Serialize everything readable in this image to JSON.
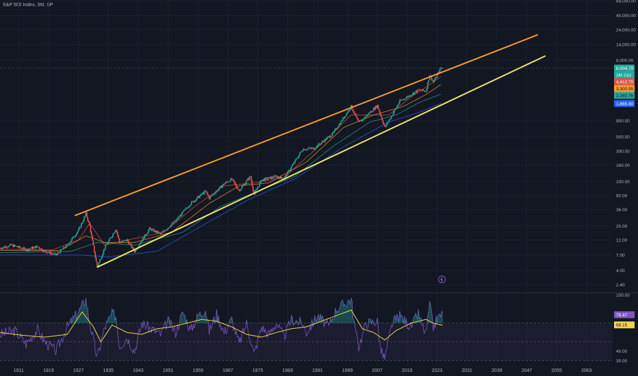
{
  "title": "S&P 500 Index, 3M, SP",
  "colors": {
    "background": "#131722",
    "up": "#26a69a",
    "down": "#ef5350",
    "upper_channel": "#f59b2d",
    "lower_channel": "#f2e46a",
    "ma_fast": "#e0524a",
    "ma_mid": "#f59b2d",
    "ma_slow": "#26a69a",
    "ma_slowest": "#2962ff",
    "rsi": "#7e57c2",
    "rsi_ma": "#f2d34d",
    "price_line": "#26a69a"
  },
  "chart_data": [
    {
      "type": "candlestick",
      "title": "S&P 500 Index, 3M, SP",
      "yscale": "log",
      "ylim": [
        1.8,
        70000
      ],
      "xlim": [
        1906,
        2070
      ],
      "x_ticks": [
        "1911",
        "1919",
        "1927",
        "1935",
        "1943",
        "1951",
        "1959",
        "1967",
        "1975",
        "1983",
        "1991",
        "1999",
        "2007",
        "2015",
        "2023",
        "2031",
        "2039",
        "2047",
        "2055",
        "2063"
      ],
      "y_ticks": [
        "68,000.00",
        "40,000.00",
        "24,000.00",
        "14,000.00",
        "8,000.00",
        "900.00",
        "500.00",
        "300.00",
        "180.00",
        "100.00",
        "60.00",
        "36.00",
        "20.00",
        "12.00",
        "7.00",
        "4.00",
        "2.40"
      ],
      "price_path": [
        [
          1906,
          9
        ],
        [
          1909,
          10
        ],
        [
          1913,
          8.5
        ],
        [
          1916,
          9.5
        ],
        [
          1918,
          8
        ],
        [
          1921,
          7
        ],
        [
          1924,
          10
        ],
        [
          1927,
          17
        ],
        [
          1929,
          31
        ],
        [
          1930,
          20
        ],
        [
          1932,
          4.5
        ],
        [
          1934,
          9
        ],
        [
          1937,
          18
        ],
        [
          1938,
          11
        ],
        [
          1940,
          12
        ],
        [
          1942,
          8
        ],
        [
          1946,
          18
        ],
        [
          1949,
          15
        ],
        [
          1953,
          24
        ],
        [
          1957,
          45
        ],
        [
          1961,
          70
        ],
        [
          1962,
          55
        ],
        [
          1966,
          92
        ],
        [
          1968,
          108
        ],
        [
          1970,
          72
        ],
        [
          1973,
          120
        ],
        [
          1974,
          63
        ],
        [
          1976,
          105
        ],
        [
          1980,
          120
        ],
        [
          1982,
          110
        ],
        [
          1987,
          320
        ],
        [
          1990,
          330
        ],
        [
          1995,
          550
        ],
        [
          2000,
          1500
        ],
        [
          2002,
          820
        ],
        [
          2007,
          1550
        ],
        [
          2009,
          700
        ],
        [
          2013,
          1800
        ],
        [
          2018,
          2700
        ],
        [
          2020,
          2600
        ],
        [
          2021,
          4700
        ],
        [
          2022,
          3600
        ],
        [
          2024,
          6000
        ]
      ],
      "moving_averages": [
        {
          "color": "#e0524a",
          "path": [
            [
              1906,
              8.6
            ],
            [
              1920,
              8.4
            ],
            [
              1927,
              12
            ],
            [
              1930,
              22
            ],
            [
              1934,
              10
            ],
            [
              1940,
              12
            ],
            [
              1950,
              16
            ],
            [
              1958,
              40
            ],
            [
              1966,
              85
            ],
            [
              1974,
              95
            ],
            [
              1982,
              115
            ],
            [
              1990,
              300
            ],
            [
              2000,
              1100
            ],
            [
              2005,
              1100
            ],
            [
              2010,
              1100
            ],
            [
              2016,
              2100
            ],
            [
              2020,
              3000
            ],
            [
              2024,
              4412
            ]
          ]
        },
        {
          "color": "#f59b2d",
          "path": [
            [
              1906,
              8.2
            ],
            [
              1922,
              8.2
            ],
            [
              1929,
              14
            ],
            [
              1934,
              11
            ],
            [
              1942,
              11
            ],
            [
              1952,
              16
            ],
            [
              1962,
              45
            ],
            [
              1970,
              85
            ],
            [
              1978,
              95
            ],
            [
              1988,
              200
            ],
            [
              1998,
              700
            ],
            [
              2006,
              1100
            ],
            [
              2014,
              1500
            ],
            [
              2020,
              2300
            ],
            [
              2024,
              3300
            ]
          ]
        },
        {
          "color": "#26a69a",
          "path": [
            [
              1906,
              7.6
            ],
            [
              1925,
              8
            ],
            [
              1932,
              11
            ],
            [
              1942,
              10
            ],
            [
              1955,
              16
            ],
            [
              1965,
              40
            ],
            [
              1975,
              70
            ],
            [
              1985,
              120
            ],
            [
              1995,
              350
            ],
            [
              2005,
              850
            ],
            [
              2012,
              1100
            ],
            [
              2018,
              1700
            ],
            [
              2024,
              2340
            ]
          ]
        },
        {
          "color": "#2962ff",
          "path": [
            [
              1906,
              7
            ],
            [
              1928,
              7
            ],
            [
              1935,
              6.5
            ],
            [
              1948,
              8
            ],
            [
              1960,
              20
            ],
            [
              1972,
              50
            ],
            [
              1985,
              110
            ],
            [
              1998,
              350
            ],
            [
              2010,
              850
            ],
            [
              2018,
              1200
            ],
            [
              2024,
              1665
            ]
          ]
        }
      ],
      "channel_lines": [
        {
          "name": "upper",
          "color": "#f59b2d",
          "from": [
            1926,
            29
          ],
          "to": [
            2050,
            20000
          ]
        },
        {
          "name": "lower",
          "color": "#f2e46a",
          "from": [
            1932,
            4.5
          ],
          "to": [
            2052,
            9300
          ]
        }
      ],
      "last_price": 6004.79,
      "value_tags": [
        {
          "value": 6004.79,
          "label": "6,004.79",
          "bg": "#26a69a",
          "fg": "#ffffff"
        },
        {
          "value": 5300,
          "label": "1M 21d",
          "bg": "#26a69a",
          "fg": "#ffffff"
        },
        {
          "value": 4412.7,
          "label": "4,412.70",
          "bg": "#e0524a",
          "fg": "#ffffff"
        },
        {
          "value": 3300,
          "label": "3,300.95",
          "bg": "#f59b2d",
          "fg": "#131722"
        },
        {
          "value": 2340,
          "label": "2,340.76",
          "bg": "#26a69a",
          "fg": "#131722"
        },
        {
          "value": 1665.6,
          "label": "1,665.60",
          "bg": "#2962ff",
          "fg": "#ffffff"
        }
      ]
    },
    {
      "type": "line",
      "name": "RSI",
      "ylim": [
        28,
        102
      ],
      "y_ticks": [
        "100.00",
        "70.00",
        "40.00",
        "30.00"
      ],
      "bands": [
        70,
        50,
        30
      ],
      "rsi": [
        [
          1906,
          58
        ],
        [
          1910,
          62
        ],
        [
          1913,
          48
        ],
        [
          1916,
          63
        ],
        [
          1918,
          50
        ],
        [
          1921,
          40
        ],
        [
          1924,
          66
        ],
        [
          1927,
          82
        ],
        [
          1929,
          96
        ],
        [
          1930,
          70
        ],
        [
          1932,
          33
        ],
        [
          1934,
          65
        ],
        [
          1936,
          80
        ],
        [
          1937,
          78
        ],
        [
          1938,
          45
        ],
        [
          1940,
          55
        ],
        [
          1942,
          40
        ],
        [
          1944,
          70
        ],
        [
          1946,
          65
        ],
        [
          1949,
          58
        ],
        [
          1951,
          72
        ],
        [
          1953,
          60
        ],
        [
          1955,
          82
        ],
        [
          1957,
          62
        ],
        [
          1959,
          78
        ],
        [
          1961,
          85
        ],
        [
          1962,
          62
        ],
        [
          1964,
          80
        ],
        [
          1966,
          60
        ],
        [
          1968,
          74
        ],
        [
          1970,
          48
        ],
        [
          1972,
          70
        ],
        [
          1974,
          37
        ],
        [
          1976,
          66
        ],
        [
          1978,
          58
        ],
        [
          1980,
          70
        ],
        [
          1982,
          55
        ],
        [
          1984,
          74
        ],
        [
          1987,
          70
        ],
        [
          1988,
          60
        ],
        [
          1991,
          78
        ],
        [
          1994,
          66
        ],
        [
          1996,
          85
        ],
        [
          1998,
          90
        ],
        [
          2000,
          96
        ],
        [
          2001,
          65
        ],
        [
          2002,
          45
        ],
        [
          2004,
          70
        ],
        [
          2007,
          72
        ],
        [
          2008,
          40
        ],
        [
          2009,
          32
        ],
        [
          2011,
          70
        ],
        [
          2013,
          78
        ],
        [
          2015,
          70
        ],
        [
          2016,
          66
        ],
        [
          2018,
          80
        ],
        [
          2019,
          68
        ],
        [
          2020,
          58
        ],
        [
          2021,
          90
        ],
        [
          2022,
          65
        ],
        [
          2023,
          75
        ],
        [
          2024,
          79
        ]
      ],
      "rsi_ma": [
        [
          1906,
          60
        ],
        [
          1912,
          57
        ],
        [
          1918,
          55
        ],
        [
          1924,
          58
        ],
        [
          1928,
          82
        ],
        [
          1931,
          66
        ],
        [
          1933,
          50
        ],
        [
          1936,
          68
        ],
        [
          1940,
          60
        ],
        [
          1944,
          58
        ],
        [
          1948,
          64
        ],
        [
          1952,
          66
        ],
        [
          1956,
          70
        ],
        [
          1960,
          74
        ],
        [
          1964,
          72
        ],
        [
          1968,
          66
        ],
        [
          1972,
          58
        ],
        [
          1976,
          55
        ],
        [
          1980,
          60
        ],
        [
          1984,
          64
        ],
        [
          1988,
          66
        ],
        [
          1992,
          72
        ],
        [
          1996,
          78
        ],
        [
          2000,
          84
        ],
        [
          2003,
          64
        ],
        [
          2006,
          60
        ],
        [
          2009,
          52
        ],
        [
          2012,
          62
        ],
        [
          2016,
          70
        ],
        [
          2020,
          74
        ],
        [
          2022,
          70
        ],
        [
          2024,
          68
        ]
      ],
      "value_tags": [
        {
          "value": 79,
          "label": "79.47",
          "bg": "#7e57c2",
          "fg": "#ffffff"
        },
        {
          "value": 68.15,
          "label": "68.15",
          "bg": "#f2d34d",
          "fg": "#131722"
        }
      ]
    }
  ]
}
